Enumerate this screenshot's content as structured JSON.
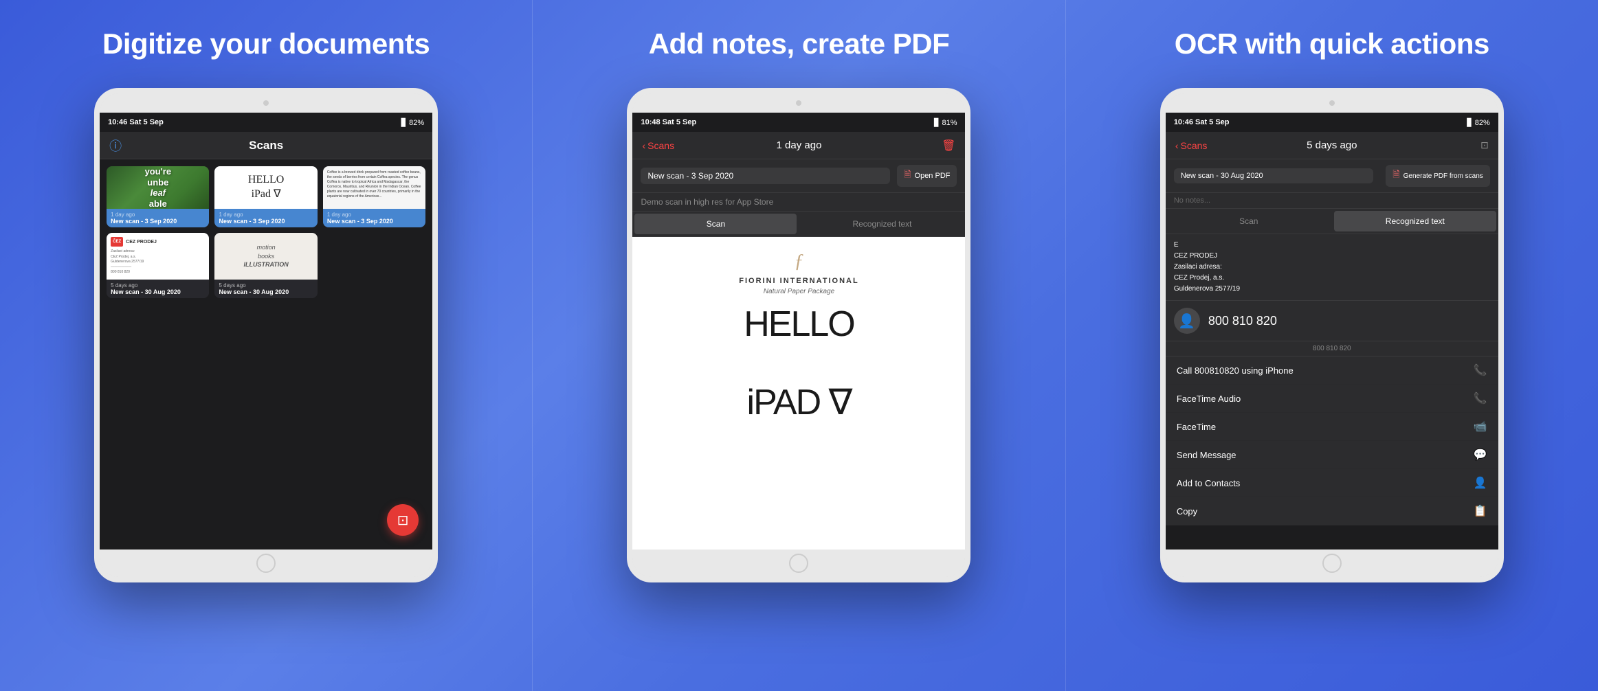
{
  "sections": [
    {
      "id": "section1",
      "title": "Digitize your documents",
      "statusBar": {
        "time": "10:46 Sat 5 Sep",
        "signal": "▊▊▊",
        "wifi": "WiFi",
        "battery": "82%"
      },
      "navTitle": "Scans",
      "scans": {
        "row1": [
          {
            "time": "1 day ago",
            "title": "New scan - 3 Sep 2020",
            "type": "leaf",
            "highlighted": true
          },
          {
            "time": "1 day ago",
            "title": "New scan - 3 Sep 2020",
            "type": "hello",
            "highlighted": true
          },
          {
            "time": "1 day ago",
            "title": "New scan - 3 Sep 2020",
            "type": "text",
            "highlighted": true
          }
        ],
        "row2": [
          {
            "time": "5 days ago",
            "title": "New scan - 30 Aug 2020",
            "type": "cez"
          },
          {
            "time": "5 days ago",
            "title": "New scan - 30 Aug 2020",
            "type": "illustration"
          }
        ]
      },
      "fab": "⊞"
    },
    {
      "id": "section2",
      "title": "Add notes, create PDF",
      "statusBar": {
        "time": "10:48 Sat 5 Sep",
        "battery": "81%"
      },
      "nav": {
        "back": "Scans",
        "center": "1 day ago",
        "trash": "🗑"
      },
      "toolbar": {
        "docTitle": "New scan - 3 Sep 2020",
        "pdfBtn": "Open PDF"
      },
      "notes": "Demo scan in high res for App Store",
      "tabs": {
        "scan": "Scan",
        "recognized": "Recognized text"
      },
      "document": {
        "logoChar": "f",
        "brand": "FIORINI INTERNATIONAL",
        "subtitle": "Natural Paper Package",
        "helloText": "HELLO",
        "ipadText": "iPAD ∇"
      }
    },
    {
      "id": "section3",
      "title": "OCR with quick actions",
      "statusBar": {
        "time": "10:46 Sat 5 Sep",
        "battery": "82%"
      },
      "nav": {
        "back": "Scans",
        "center": "5 days ago"
      },
      "toolbar": {
        "docTitle": "New scan - 30 Aug 2020",
        "pdfBtn": "Generate PDF from scans"
      },
      "notes": "No notes...",
      "tabs": {
        "scan": "Scan",
        "recognized": "Recognized text"
      },
      "ocrText": {
        "lines": [
          "E",
          "CEZ PRODEJ",
          "Zasilaci adresa:",
          "CEZ Prodej, a.s.",
          "Guldenerova 2577/19"
        ]
      },
      "contact": {
        "number": "800 810 820"
      },
      "actionMenu": {
        "phoneLabel": "800 810 820",
        "items": [
          {
            "label": "Call 800810820 using iPhone",
            "icon": "📞"
          },
          {
            "label": "FaceTime Audio",
            "icon": "📞"
          },
          {
            "label": "FaceTime",
            "icon": "📹"
          },
          {
            "label": "Send Message",
            "icon": "💬"
          },
          {
            "label": "Add to Contacts",
            "icon": "👤"
          },
          {
            "label": "Copy",
            "icon": "📋"
          }
        ]
      }
    }
  ]
}
